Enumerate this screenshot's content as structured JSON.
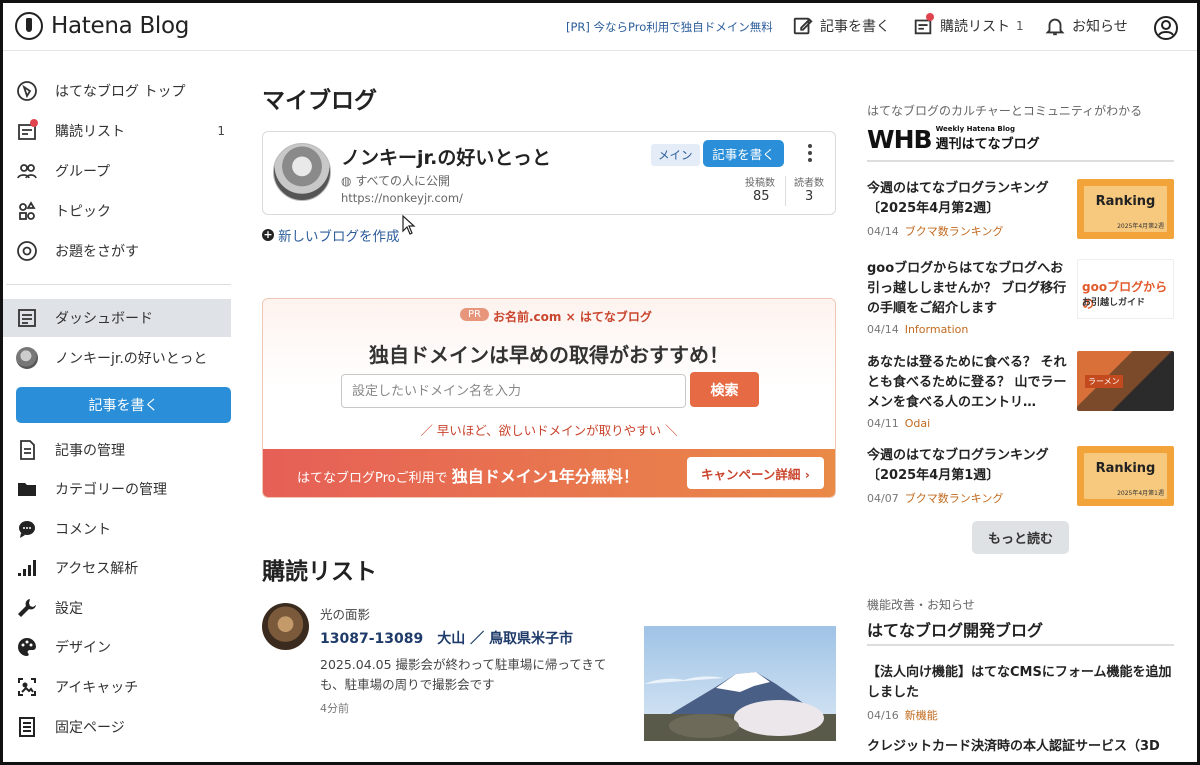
{
  "header": {
    "logo_text": "Hatena Blog",
    "pr_link": "[PR] 今ならPro利用で独自ドメイン無料",
    "write_label": "記事を書く",
    "subscriptions_label": "購読リスト",
    "subscriptions_count": "1",
    "notifications_label": "お知らせ"
  },
  "sidebar": {
    "items": [
      {
        "label": "はてなブログ トップ",
        "icon": "hatena-top-icon"
      },
      {
        "label": "購読リスト",
        "icon": "subscription-icon",
        "count": "1"
      },
      {
        "label": "グループ",
        "icon": "group-icon"
      },
      {
        "label": "トピック",
        "icon": "topic-icon"
      },
      {
        "label": "お題をさがす",
        "icon": "theme-search-icon"
      }
    ],
    "dashboard_label": "ダッシュボード",
    "blog_label": "ノンキーjr.の好いとっと",
    "write_button": "記事を書く",
    "manage_items": [
      {
        "label": "記事の管理",
        "icon": "document-icon"
      },
      {
        "label": "カテゴリーの管理",
        "icon": "folder-icon"
      },
      {
        "label": "コメント",
        "icon": "comment-icon"
      },
      {
        "label": "アクセス解析",
        "icon": "bar-chart-icon"
      },
      {
        "label": "設定",
        "icon": "wrench-icon"
      },
      {
        "label": "デザイン",
        "icon": "palette-icon"
      },
      {
        "label": "アイキャッチ",
        "icon": "eyecatch-icon"
      },
      {
        "label": "固定ページ",
        "icon": "fixed-page-icon"
      }
    ]
  },
  "main": {
    "my_blog_title": "マイブログ",
    "blog": {
      "name": "ノンキーjr.の好いとっと",
      "visibility": "すべての人に公開",
      "url": "https://nonkeyjr.com/",
      "main_tag": "メイン",
      "write_button": "記事を書く",
      "posts_label": "投稿数",
      "posts_value": "85",
      "readers_label": "読者数",
      "readers_value": "3"
    },
    "new_blog_link": "新しいブログを作成",
    "promo": {
      "pr_pill": "PR",
      "brand": "お名前.com × はてなブログ",
      "headline": "独自ドメインは早めの取得がおすすめ！",
      "input_placeholder": "設定したいドメイン名を入力",
      "search_button": "検索",
      "sub": "／ 早いほど、欲しいドメインが取りやすい ＼",
      "band_prefix": "はてなブログProご利用で",
      "band_emphasis": "独自ドメイン1年分無料！",
      "campaign_button": "キャンペーン詳細 ›"
    },
    "subscriptions_title": "購読リスト",
    "feed": {
      "blog_name": "光の面影",
      "title": "13087-13089　大山 ／ 鳥取県米子市",
      "desc": "2025.04.05 撮影会が終わって駐車場に帰ってきても、駐車場の周りで撮影会です",
      "time": "4分前"
    }
  },
  "right": {
    "caption": "はてなブログのカルチャーとコミュニティがわかる",
    "whb_big": "WHB",
    "whb_en": "Weekly Hatena Blog",
    "whb_jp": "週刊はてなブログ",
    "articles": [
      {
        "title": "今週のはてなブログランキング〔2025年4月第2週〕",
        "date": "04/14",
        "category": "ブクマ数ランキング",
        "thumb_text": "Ranking",
        "thumb_sub": "2025年4月第2週"
      },
      {
        "title": "gooブログからはてなブログへお引っ越ししませんか？ ブログ移行の手順をご紹介します",
        "date": "04/14",
        "category": "Information",
        "thumb_text": "gooブログからの",
        "thumb_sub": "お引越しガイド"
      },
      {
        "title": "あなたは登るために食べる？ それとも食べるために登る？ 山でラーメンを食べる人のエントリ…",
        "date": "04/11",
        "category": "Odai",
        "thumb_sub": "ラーメン"
      },
      {
        "title": "今週のはてなブログランキング〔2025年4月第1週〕",
        "date": "04/07",
        "category": "ブクマ数ランキング",
        "thumb_text": "Ranking",
        "thumb_sub": "2025年4月第1週"
      }
    ],
    "more_button": "もっと読む",
    "dev_caption": "機能改善・お知らせ",
    "dev_title": "はてなブログ開発ブログ",
    "dev_items": [
      {
        "title": "【法人向け機能】はてなCMSにフォーム機能を追加しました",
        "date": "04/16",
        "category": "新機能"
      },
      {
        "title": "クレジットカード決済時の本人認証サービス（3D"
      }
    ]
  }
}
